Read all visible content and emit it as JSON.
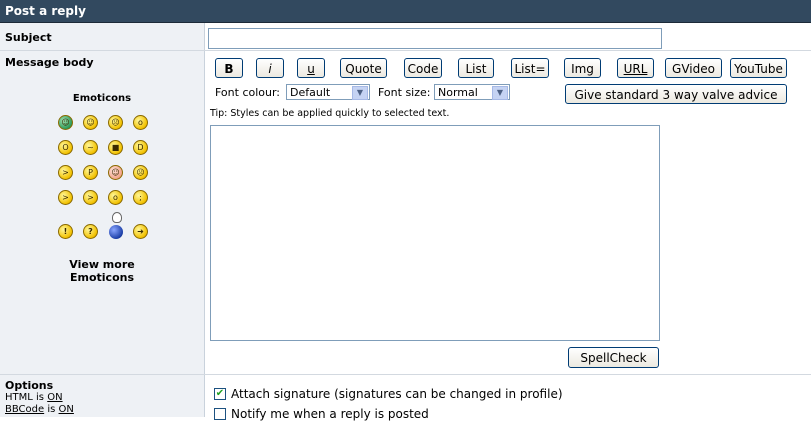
{
  "title": "Post a reply",
  "subject": {
    "label": "Subject",
    "value": ""
  },
  "message_body": {
    "label": "Message body"
  },
  "emoticons": {
    "heading": "Emoticons",
    "items": [
      "very-happy",
      "smile",
      "sad",
      "surprised",
      "shocked",
      "confused",
      "cool",
      "laughing",
      "mad",
      "razz",
      "embarrassed",
      "crying",
      "evil",
      "twisted",
      "rolling-eyes",
      "wink",
      "exclamation",
      "question",
      "idea",
      "arrow"
    ],
    "view_more_line1": "View more",
    "view_more_line2": "Emoticons"
  },
  "toolbar": {
    "buttons": [
      "B",
      "i",
      "u",
      "Quote",
      "Code",
      "List",
      "List=",
      "Img",
      "URL",
      "GVideo",
      "YouTube"
    ],
    "font_colour_label": "Font colour:",
    "font_colour_value": "Default",
    "font_size_label": "Font size:",
    "font_size_value": "Normal",
    "advice_button": "Give standard 3 way valve advice"
  },
  "tip": "Tip: Styles can be applied quickly to selected text.",
  "message_text": "",
  "spellcheck_button": "SpellCheck",
  "options": {
    "label": "Options",
    "html_prefix": "HTML",
    "is": "is",
    "html_status": "ON",
    "bbcode_label": "BBCode",
    "bbcode_status": "ON",
    "attach_signature": "Attach signature (signatures can be changed in profile)",
    "attach_signature_checked": true,
    "notify_reply": "Notify me when a reply is posted",
    "notify_reply_checked": false
  }
}
